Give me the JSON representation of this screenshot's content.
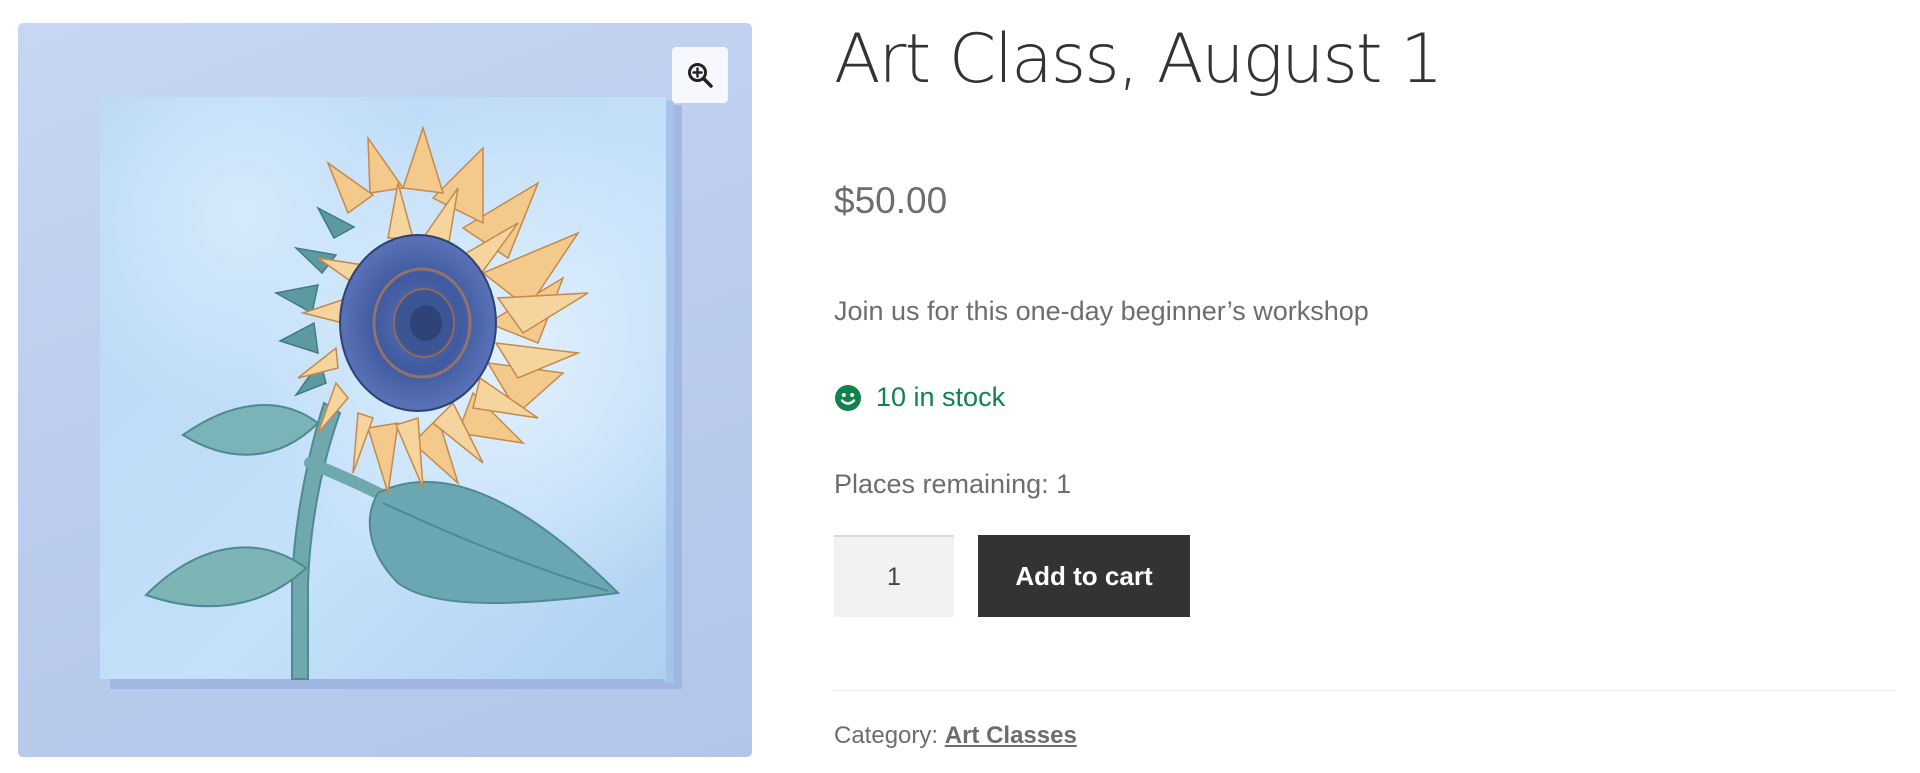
{
  "product": {
    "title": "Art Class, August 1",
    "price": "$50.00",
    "short_description": "Join us for this one-day beginner’s workshop",
    "stock": {
      "text": "10 in stock",
      "icon": "smiley-face-icon",
      "color": "#0f834d"
    },
    "places_remaining": "Places remaining: 1",
    "quantity": "1",
    "add_to_cart_label": "Add to cart",
    "category_label": "Category:",
    "category_value": "Art Classes"
  },
  "gallery": {
    "zoom_icon": "zoom-in-magnifier-icon",
    "image_subject": "sunflower painting on canvas"
  },
  "colors": {
    "button_bg": "#333333",
    "button_text": "#ffffff",
    "stock_green": "#0f834d",
    "text_muted": "#6d6d6d",
    "title_text": "#333333"
  }
}
